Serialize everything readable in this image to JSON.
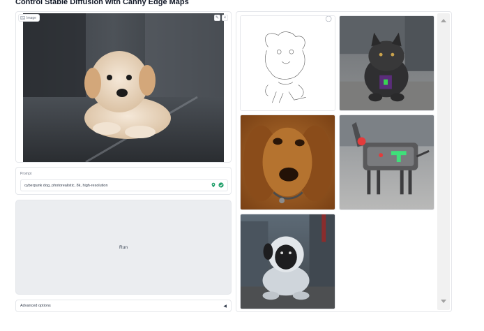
{
  "title": "Control Stable Diffusion with Canny Edge Maps",
  "image_panel": {
    "label": "Image",
    "edit_icon": "pencil-icon",
    "close_icon": "close-icon"
  },
  "prompt": {
    "label": "Prompt",
    "value": "cyberpunk dog, photorealistic, 8k, high-resolution"
  },
  "run_label": "Run",
  "advanced_label": "Advanced options",
  "gallery": {
    "items": [
      "canny-edge-map",
      "dark-dog-render",
      "brown-dog-portrait",
      "robot-dog",
      "astronaut-dog"
    ]
  },
  "colors": {
    "border": "#e5e7eb",
    "run_bg": "#ebedf0",
    "prompt_icon_green": "#22a06b"
  }
}
